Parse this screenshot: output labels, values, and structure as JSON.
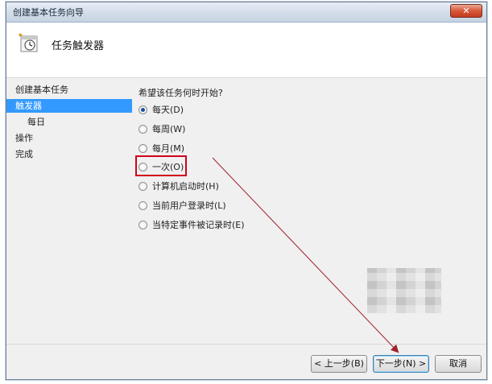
{
  "window": {
    "title": "创建基本任务向导",
    "close_glyph": "✕"
  },
  "header": {
    "title": "任务触发器",
    "icon": "calendar-clock-icon"
  },
  "sidebar": {
    "items": [
      {
        "label": "创建基本任务"
      },
      {
        "label": "触发器"
      },
      {
        "label": "每日"
      },
      {
        "label": "操作"
      },
      {
        "label": "完成"
      }
    ]
  },
  "content": {
    "question": "希望该任务何时开始?",
    "options": [
      {
        "label": "每天(D)",
        "checked": true
      },
      {
        "label": "每周(W)",
        "checked": false
      },
      {
        "label": "每月(M)",
        "checked": false
      },
      {
        "label": "一次(O)",
        "checked": false
      },
      {
        "label": "计算机启动时(H)",
        "checked": false
      },
      {
        "label": "当前用户登录时(L)",
        "checked": false
      },
      {
        "label": "当特定事件被记录时(E)",
        "checked": false
      }
    ]
  },
  "footer": {
    "back_label": "< 上一步(B)",
    "next_label": "下一步(N) >",
    "cancel_label": "取消"
  },
  "annotation": {
    "highlight_color": "#d0021b",
    "arrow_color": "#a0212b"
  },
  "colors": {
    "selected_bg": "#3399ff",
    "radio_dot": "#1c4f9c"
  }
}
